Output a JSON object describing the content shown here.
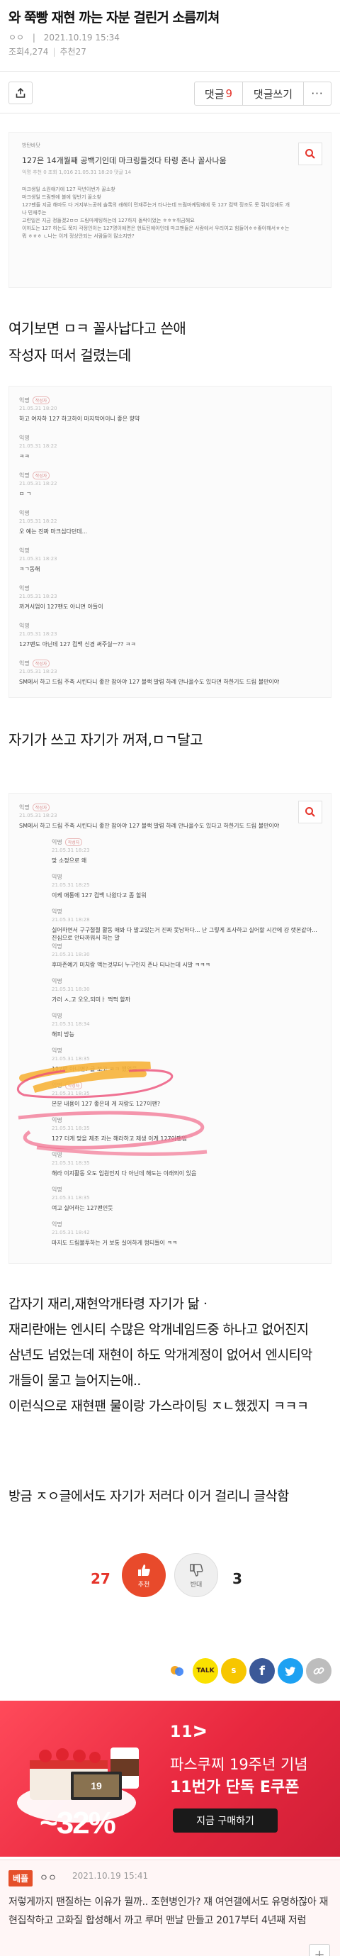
{
  "post": {
    "title": "와 쭉빵 재현 까는 자분 걸린거 소름끼쳐",
    "author": "ㅇㅇ",
    "sep": "|",
    "date": "2021.10.19 15:34",
    "views": "조회4,274",
    "recommend": "추천27"
  },
  "toolbar": {
    "comment_label": "댓글",
    "comment_count": "9",
    "write_label": "댓글쓰기",
    "more_label": "···"
  },
  "shot1": {
    "category": "방탄바닷",
    "title": "127은 14개월째 공백기인데 마크링들것다 타령 존나 꼴사나움",
    "meta": "익명  추천 0  조회 1,016  21.05.31 18:20  댓글 14",
    "body": [
      "마크생일 소원얘기에 127 작년이번가 꼴소찾",
      "마크생일 드림팬에 블에 앞반기 꼴소찾",
      "127팬들 지금 해마도 다 거지부느공헤 솔록의 래헤이 민재주는거 타나는데 드림마케팅에에 둑 127 컴백 징조도 못 줘지않애도 개나 민재주는",
      "고련일은 지금 정들겠2ㅁㅁ 드림마케팅하는데 127하지 돌락이었는 ㅎㅎㅎ취금해요",
      "이하도는 127 하는도 쭉자 각정인이는 127명이에면은 헌트틴에아인데 마크팬들은 사람에서 우리여고 힘들어ㅎㅎ좋아해서ㅎㅎ는 뭐 ㅎㅎㅎ ㄴ나는 이게 정상안되는 서람들이 많소지만?"
    ]
  },
  "text1": [
    "여기보면 ㅁㅋ 꼴사납다고 쓴애",
    "작성자 떠서 걸렸는데"
  ],
  "shot2": {
    "comments": [
      {
        "name": "익명",
        "badge": "작성자",
        "time": "21.05.31 18:20",
        "body": "하고 여자하 127 하고하이 마지막어이니 좋은 향약"
      },
      {
        "name": "익명",
        "badge": "",
        "time": "21.05.31 18:22",
        "body": "ㅋㅋ"
      },
      {
        "name": "익명",
        "badge": "작성자",
        "time": "21.05.31 18:22",
        "body": "ㅁ ㄱ"
      },
      {
        "name": "익명",
        "badge": "",
        "time": "21.05.31 18:22",
        "body": "오 예는 진짜 마크심다던데..."
      },
      {
        "name": "익명",
        "badge": "",
        "time": "21.05.31 18:23",
        "body": "ㅋㄱ동해"
      },
      {
        "name": "익명",
        "badge": "",
        "time": "21.05.31 18:23",
        "body": "까겨서엄이 127팬도 아니면 아들이"
      },
      {
        "name": "익명",
        "badge": "",
        "time": "21.05.31 18:23",
        "body": "127팬도 아닌데 127 컴백 신경 써주실ㅡ?? ㅋㅋ"
      },
      {
        "name": "익명",
        "badge": "작성자",
        "time": "21.05.31 18:23",
        "body": "SM에서 하고 드림 주축 시킨다니 좋잔 참아야 127 블랙 발렴 하례 안나올수도 있다면 하한기도 드림 볼만이야"
      }
    ]
  },
  "text2": [
    "자기가 쓰고 자기가 꺼져,ㅁㄱ달고"
  ],
  "shot3": {
    "comments": [
      {
        "name": "익명",
        "badge": "작성자",
        "time": "21.05.31 18:23",
        "body": "SM에서 하고 드림 주축 시킨다니 좋잔 참아야 127 블랙 발렴 하례 안나올수도 있다고 하한기도 드림 볼만이야",
        "in": false
      },
      {
        "name": "익명",
        "badge": "작성자",
        "time": "21.05.31 18:23",
        "body": "맞 소정으로 왜",
        "in": true
      },
      {
        "name": "익명",
        "badge": "",
        "time": "21.05.31 18:25",
        "body": "이케 애통에 127 컴백 나왔다고 좀 힐워",
        "in": true
      },
      {
        "name": "익명",
        "badge": "",
        "time": "21.05.31 18:28",
        "body": "실어하면서 구구절절 활동 애봐 다 발고있는거 진짜 못남하다... 난 그렇게 조사하고 실어할 시간에 걍 랫본같아... 진심으로 안타까워서 하는 말",
        "in": true
      },
      {
        "name": "익명",
        "badge": "",
        "time": "21.05.31 18:30",
        "body": "후마존예기 미치랑 맥는것부터 누구인지 존나 티나는데 시발 ㅋㅋㅋ",
        "in": true
      },
      {
        "name": "익명",
        "badge": "",
        "time": "21.05.31 18:30",
        "body": "가러 ㅅ,고 오오,되미ㅏ 쩍쩍 할까",
        "in": true
      },
      {
        "name": "익명",
        "badge": "",
        "time": "21.05.31 18:34",
        "body": "해피 방능",
        "in": true
      },
      {
        "name": "익명",
        "badge": "",
        "time": "21.05.31 18:35",
        "body": "127팬 아니면? 글 보고 ㅋㅋ 했었음",
        "in": true
      },
      {
        "name": "익명",
        "badge": "작성자",
        "time": "21.05.31 18:35",
        "body": "본분 내용이 127 좋은데 게 저랑도 127이팬?",
        "in": true
      },
      {
        "name": "익명",
        "badge": "",
        "time": "21.05.31 18:35",
        "body": "127 더게 맞을 제조 과는 해라하고 제생 이게 127이팬임",
        "in": true
      },
      {
        "name": "익명",
        "badge": "",
        "time": "21.05.31 18:35",
        "body": "해라 이지활동 오도 입원인지 다 아닌데 해도는 이래외이 있음",
        "in": true
      },
      {
        "name": "익명",
        "badge": "",
        "time": "21.05.31 18:35",
        "body": "여고 실어하는 127팬인듯",
        "in": true
      },
      {
        "name": "익명",
        "badge": "",
        "time": "21.05.31 18:42",
        "body": "마지도 드림불투하는 거 보통 실어하게 험티들이 ㅋㅋ",
        "in": true
      }
    ]
  },
  "text3": [
    "갑자기 재리,재현악개타령 자기가 닮ㆍ",
    "재리란애는 엔시티 수많은 악개네임드중 하나고 없어진지",
    "삼년도 넘었는데 재현이 하도 악개계정이 없어서 엔시티악",
    "개들이 물고 늘어지는애..",
    "이런식으로 재현팬 물이랑 가스라이팅 ㅈㄴ했겠지 ㅋㅋㅋ"
  ],
  "text4": [
    "방금 ㅈㅇ글에서도 자기가 저러다 이거 걸리니 글삭함"
  ],
  "vote": {
    "up_count": "27",
    "up_label": "추천",
    "down_count": "3",
    "down_label": "반대"
  },
  "social": {
    "talk": "TALK",
    "facebook": "f",
    "story": "S"
  },
  "ad": {
    "brand": "11ᐳ",
    "line1": "파스쿠찌 19주년 기념",
    "line2": "11번가 단독 E쿠폰",
    "button": "지금 구매하기",
    "discount": "~32%",
    "badge": "19"
  },
  "comment": {
    "badge": "베플",
    "nick": "ㅇㅇ",
    "date": "2021.10.19 15:41",
    "text": "저렇게까지 팬질하는 이유가 뭘까.. 조현병인가? 쟤 여연갤에서도 유명하잖아 재현집착하고 고화질 합성해서 까고 루머 맨날 만들고 2017부터 4년째 저럼",
    "plus": "+"
  },
  "colors": {
    "accent": "#e5332a",
    "ad_bg": "#e8283f",
    "best": "#e5502a"
  }
}
